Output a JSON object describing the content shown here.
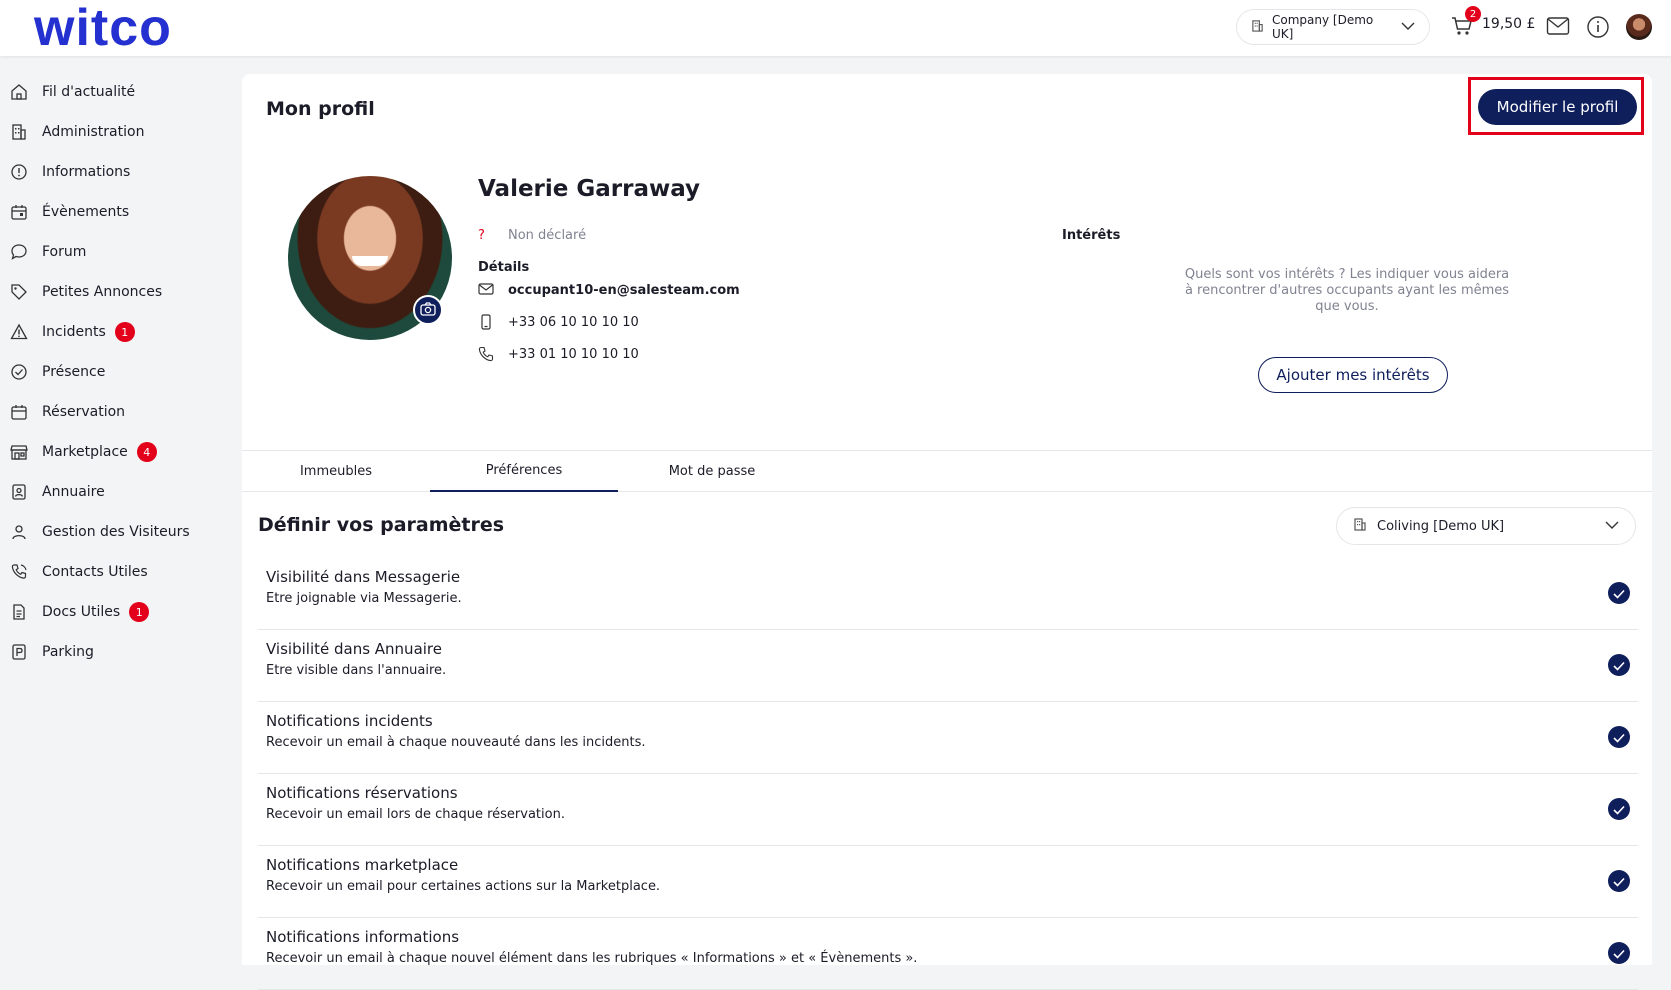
{
  "app": {
    "logo": "witco"
  },
  "header": {
    "company": "Company [Demo UK]",
    "cart_count": "2",
    "cart_amount": "19,50 £"
  },
  "sidebar": {
    "items": [
      {
        "label": "Fil d'actualité",
        "icon": "home-icon",
        "badge": null
      },
      {
        "label": "Administration",
        "icon": "building-icon",
        "badge": null
      },
      {
        "label": "Informations",
        "icon": "info-icon",
        "badge": null
      },
      {
        "label": "Évènements",
        "icon": "calendar-event-icon",
        "badge": null
      },
      {
        "label": "Forum",
        "icon": "chat-icon",
        "badge": null
      },
      {
        "label": "Petites Annonces",
        "icon": "tag-icon",
        "badge": null
      },
      {
        "label": "Incidents",
        "icon": "warning-icon",
        "badge": "1"
      },
      {
        "label": "Présence",
        "icon": "check-circle-icon",
        "badge": null
      },
      {
        "label": "Réservation",
        "icon": "calendar-icon",
        "badge": null
      },
      {
        "label": "Marketplace",
        "icon": "store-icon",
        "badge": "4"
      },
      {
        "label": "Annuaire",
        "icon": "contact-book-icon",
        "badge": null
      },
      {
        "label": "Gestion des Visiteurs",
        "icon": "visitor-icon",
        "badge": null
      },
      {
        "label": "Contacts Utiles",
        "icon": "phone-call-icon",
        "badge": null
      },
      {
        "label": "Docs Utiles",
        "icon": "document-icon",
        "badge": "1"
      },
      {
        "label": "Parking",
        "icon": "parking-icon",
        "badge": null
      }
    ]
  },
  "profile": {
    "page_title": "Mon profil",
    "edit_button": "Modifier le profil",
    "name": "Valerie Garraway",
    "gender": "Non déclaré",
    "details_label": "Détails",
    "email": "occupant10-en@salesteam.com",
    "mobile": "+33 06 10 10 10 10",
    "phone": "+33 01 10 10 10 10",
    "interests_label": "Intérêts",
    "interests_text": "Quels sont vos intérêts ? Les indiquer vous aidera à rencontrer d'autres occupants ayant les mêmes que vous.",
    "interests_button": "Ajouter mes intérêts"
  },
  "tabs": [
    {
      "label": "Immeubles",
      "active": false
    },
    {
      "label": "Préférences",
      "active": true
    },
    {
      "label": "Mot de passe",
      "active": false
    }
  ],
  "preferences": {
    "title": "Définir vos paramètres",
    "building": "Coliving [Demo UK]",
    "items": [
      {
        "title": "Visibilité dans Messagerie",
        "desc": "Etre joignable via Messagerie.",
        "checked": true
      },
      {
        "title": "Visibilité dans Annuaire",
        "desc": "Etre visible dans l'annuaire.",
        "checked": true
      },
      {
        "title": "Notifications incidents",
        "desc": "Recevoir un email à chaque nouveauté dans les incidents.",
        "checked": true
      },
      {
        "title": "Notifications réservations",
        "desc": "Recevoir un email lors de chaque réservation.",
        "checked": true
      },
      {
        "title": "Notifications marketplace",
        "desc": "Recevoir un email pour certaines actions sur la Marketplace.",
        "checked": true
      },
      {
        "title": "Notifications informations",
        "desc": "Recevoir un email à chaque nouvel élément dans les rubriques « Informations » et « Évènements ».",
        "checked": true
      }
    ]
  },
  "colors": {
    "accent": "#0f1f5c",
    "brand": "#2430d0",
    "badge": "#e3001b"
  }
}
